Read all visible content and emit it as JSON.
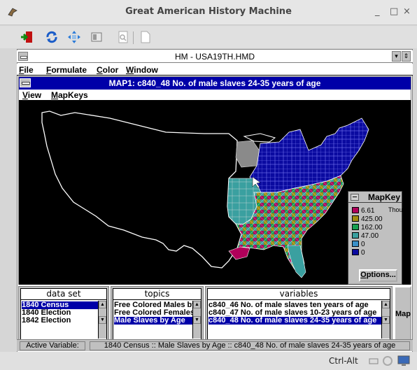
{
  "window": {
    "title": "Great American History Machine",
    "minimize": "_",
    "maximize": "□",
    "close": "×"
  },
  "toolbar": {
    "icons": [
      "exit-icon",
      "refresh-icon",
      "move-icon",
      "panel-icon",
      "preview-icon",
      "document-icon"
    ]
  },
  "document": {
    "title": "HM - USA19TH.HMD",
    "down_btn": "▾",
    "updown_btn": "⇕"
  },
  "menu": {
    "items": [
      "File",
      "Formulate",
      "Color",
      "Window"
    ]
  },
  "map_window": {
    "title": "MAP1: c840_48 No. of male slaves 24-35 years of age",
    "menu": [
      "View",
      "MapKeys"
    ]
  },
  "mapkey": {
    "title": "MapKey",
    "units": "Thous",
    "entries": [
      {
        "label": "6.61",
        "color": "#b0005a"
      },
      {
        "label": "425.00",
        "color": "#a08c10"
      },
      {
        "label": "162.00",
        "color": "#18a050"
      },
      {
        "label": "47.00",
        "color": "#3aa0a0"
      },
      {
        "label": "0",
        "color": "#3a90c8"
      },
      {
        "label": "0",
        "color": "#0a0aa0"
      }
    ],
    "options_button": "Options..."
  },
  "panels": {
    "data_set": {
      "header": "data set",
      "items": [
        "1840 Census",
        "1840 Election",
        "1842 Election"
      ],
      "selected": 0
    },
    "topics": {
      "header": "topics",
      "items": [
        "Free Colored Males by",
        "Free Colored Females",
        "Male Slaves by Age"
      ],
      "selected": 2
    },
    "variables": {
      "header": "variables",
      "items": [
        "c840_46 No. of male slaves ten years of age",
        "c840_47 No. of male slaves 10-23 years of age",
        "c840_48 No. of male slaves 24-35 years of age"
      ],
      "selected": 2
    },
    "map_button": "Map"
  },
  "status": {
    "label": "Active Variable:",
    "value": "1840 Census :: Male Slaves by Age :: c840_48 No. of male slaves 24-35 years of age"
  },
  "bottom": {
    "shortcut": "Ctrl-Alt"
  }
}
